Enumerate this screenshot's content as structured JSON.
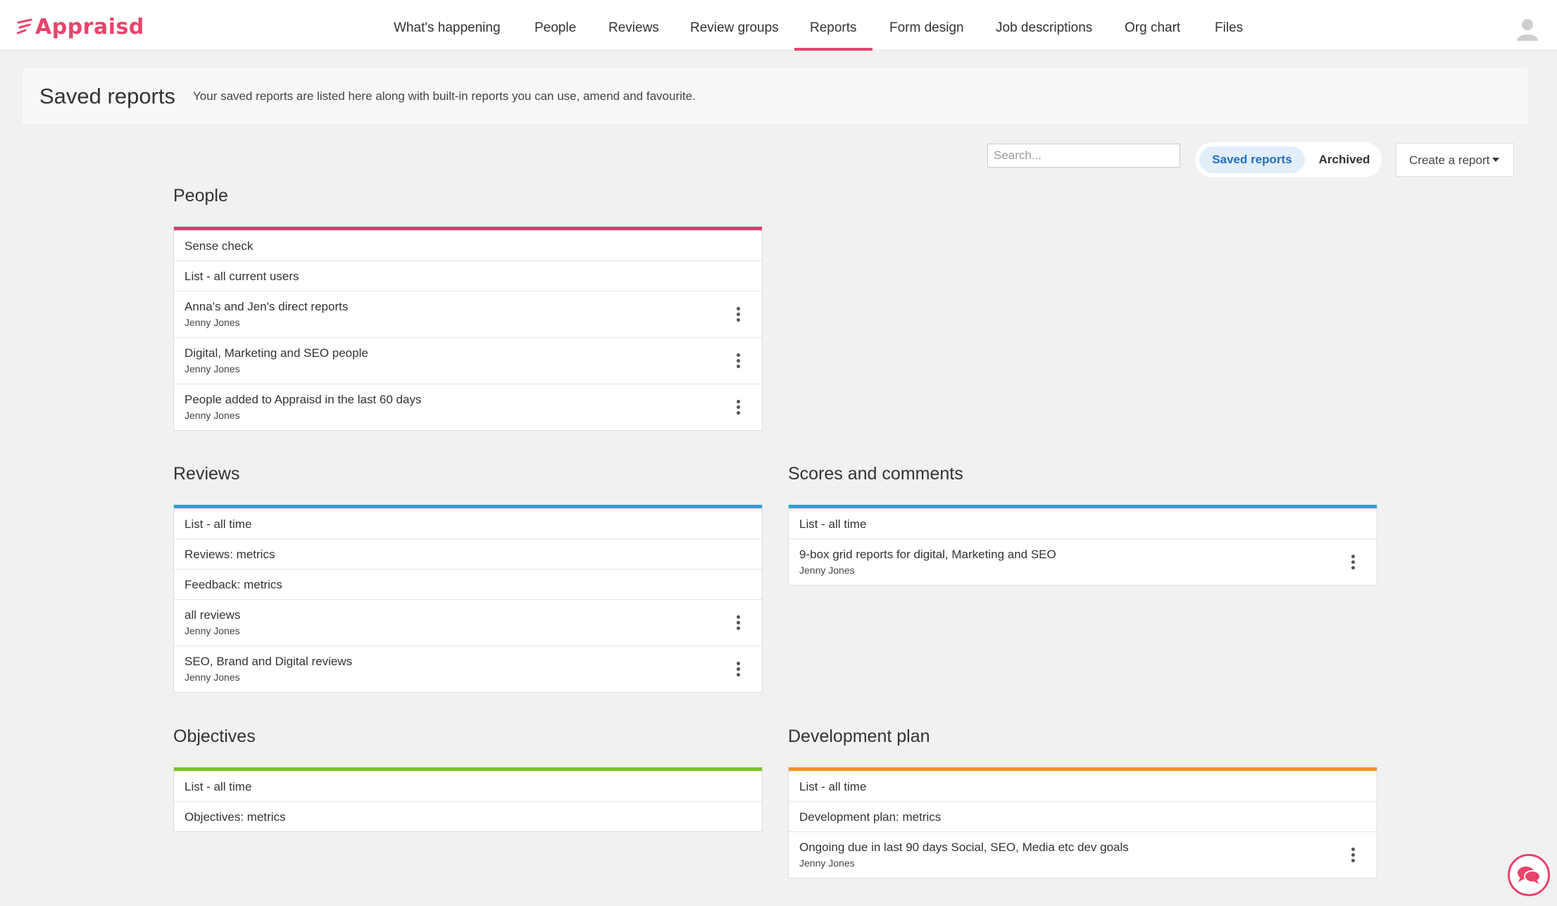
{
  "brand": {
    "name": "Appraisd",
    "color": "#e8436b"
  },
  "nav": {
    "items": [
      "What's happening",
      "People",
      "Reviews",
      "Review groups",
      "Reports",
      "Form design",
      "Job descriptions",
      "Org chart",
      "Files"
    ],
    "active": "Reports"
  },
  "header": {
    "title": "Saved reports",
    "description": "Your saved reports are listed here along with built-in reports you can use, amend and favourite."
  },
  "toolbar": {
    "search_placeholder": "Search...",
    "toggle_saved": "Saved reports",
    "toggle_archived": "Archived",
    "create_label": "Create a report"
  },
  "sections": {
    "people": {
      "title": "People",
      "color": "#e03a6f",
      "rows": [
        {
          "title": "Sense check",
          "owner": ""
        },
        {
          "title": "List - all current users",
          "owner": ""
        },
        {
          "title": "Anna's and Jen's direct reports",
          "owner": "Jenny Jones"
        },
        {
          "title": "Digital, Marketing and SEO people",
          "owner": "Jenny Jones"
        },
        {
          "title": "People added to Appraisd in the last 60 days",
          "owner": "Jenny Jones"
        }
      ]
    },
    "reviews": {
      "title": "Reviews",
      "color": "#25a7cf",
      "rows": [
        {
          "title": "List - all time",
          "owner": ""
        },
        {
          "title": "Reviews: metrics",
          "owner": ""
        },
        {
          "title": "Feedback: metrics",
          "owner": ""
        },
        {
          "title": "all reviews",
          "owner": "Jenny Jones"
        },
        {
          "title": "SEO, Brand and Digital reviews",
          "owner": "Jenny Jones"
        }
      ]
    },
    "scores": {
      "title": "Scores and comments",
      "color": "#25a7cf",
      "rows": [
        {
          "title": "List - all time",
          "owner": ""
        },
        {
          "title": "9-box grid reports for digital, Marketing and SEO",
          "owner": "Jenny Jones"
        }
      ]
    },
    "objectives": {
      "title": "Objectives",
      "color": "#7cc31f",
      "rows": [
        {
          "title": "List - all time",
          "owner": ""
        },
        {
          "title": "Objectives: metrics",
          "owner": ""
        }
      ]
    },
    "development": {
      "title": "Development plan",
      "color": "#f39323",
      "rows": [
        {
          "title": "List - all time",
          "owner": ""
        },
        {
          "title": "Development plan: metrics",
          "owner": ""
        },
        {
          "title": "Ongoing due in last 90 days Social, SEO, Media etc dev goals",
          "owner": "Jenny Jones"
        }
      ]
    }
  }
}
